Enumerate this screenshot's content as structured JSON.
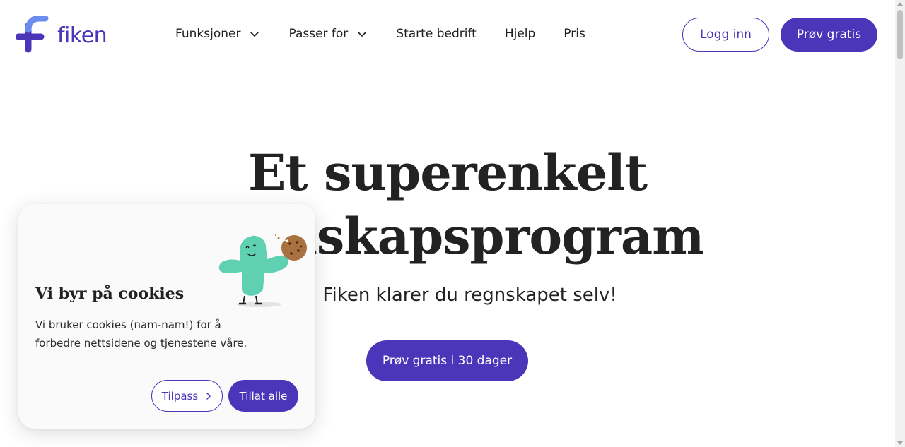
{
  "brand": {
    "name": "fiken",
    "accent": "#4b35b8",
    "logo_light": "#6d8cf0"
  },
  "nav": {
    "items": [
      {
        "label": "Funksjoner",
        "has_dropdown": true
      },
      {
        "label": "Passer for",
        "has_dropdown": true
      },
      {
        "label": "Starte bedrift",
        "has_dropdown": false
      },
      {
        "label": "Hjelp",
        "has_dropdown": false
      },
      {
        "label": "Pris",
        "has_dropdown": false
      }
    ],
    "login_label": "Logg inn",
    "trial_label": "Prøv gratis"
  },
  "hero": {
    "title_line1": "Et superenkelt",
    "title_line2": "regnskapsprogram",
    "subtitle": "Med Fiken klarer du regnskapet selv!",
    "cta_label": "Prøv gratis i 30 dager"
  },
  "cookie": {
    "title": "Vi byr på cookies",
    "text": "Vi bruker cookies (nam-nam!) for å forbedre nettsidene og tjenestene våre.",
    "customize_label": "Tilpass",
    "accept_label": "Tillat alle",
    "illustration": "cookie-monster-illustration"
  }
}
